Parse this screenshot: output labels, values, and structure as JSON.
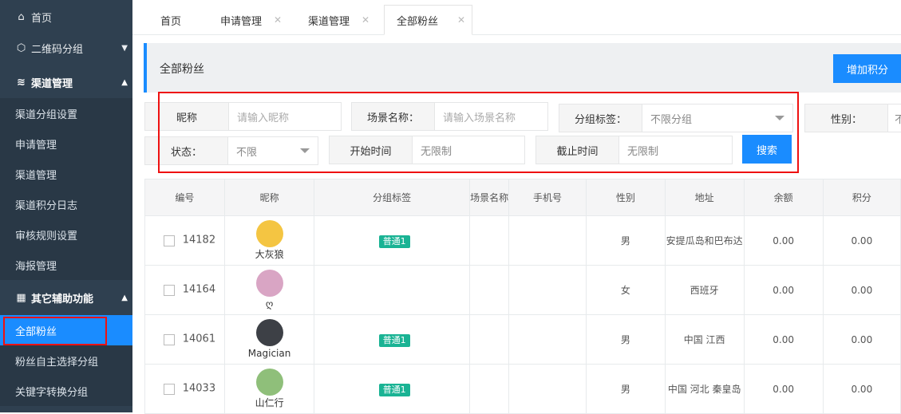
{
  "sidebar": {
    "home": "首页",
    "qrcode_group": "二维码分组",
    "channel_mgmt": "渠道管理",
    "channel_items": [
      "渠道分组设置",
      "申请管理",
      "渠道管理",
      "渠道积分日志",
      "审核规则设置",
      "海报管理"
    ],
    "other_tools": "其它辅助功能",
    "other_items": [
      "全部粉丝",
      "粉丝自主选择分组",
      "关键字转换分组"
    ]
  },
  "tabs": [
    {
      "label": "首页",
      "closable": false
    },
    {
      "label": "申请管理",
      "closable": true
    },
    {
      "label": "渠道管理",
      "closable": true
    },
    {
      "label": "全部粉丝",
      "closable": true,
      "active": true
    }
  ],
  "page": {
    "title": "全部粉丝",
    "add_points_button": "增加积分"
  },
  "filters": {
    "nickname": {
      "label": "昵称",
      "placeholder": "请输入昵称"
    },
    "scene": {
      "label": "场景名称：",
      "placeholder": "请输入场景名称"
    },
    "group_tag": {
      "label": "分组标签：",
      "value": "不限分组"
    },
    "gender": {
      "label": "性别：",
      "value": "不"
    },
    "status": {
      "label": "状态：",
      "value": "不限"
    },
    "start_time": {
      "label": "开始时间",
      "value": "无限制"
    },
    "end_time": {
      "label": "截止时间",
      "value": "无限制"
    },
    "search_button": "搜索"
  },
  "table": {
    "columns": [
      "编号",
      "昵称",
      "分组标签",
      "场景名称",
      "手机号",
      "性别",
      "地址",
      "余额",
      "积分"
    ],
    "rows": [
      {
        "id": "14182",
        "nickname": "大灰狼",
        "tag": "普通1",
        "scene": "",
        "phone": "",
        "gender": "男",
        "address": "安提瓜岛和巴布达",
        "balance": "0.00",
        "points": "0.00",
        "avatar_color": "#f4c542"
      },
      {
        "id": "14164",
        "nickname": "ღ",
        "tag": "",
        "scene": "",
        "phone": "",
        "gender": "女",
        "address": "西班牙",
        "balance": "0.00",
        "points": "0.00",
        "avatar_color": "#d9a5c4"
      },
      {
        "id": "14061",
        "nickname": "Magician",
        "tag": "普通1",
        "scene": "",
        "phone": "",
        "gender": "男",
        "address": "中国 江西",
        "balance": "0.00",
        "points": "0.00",
        "avatar_color": "#3d4046"
      },
      {
        "id": "14033",
        "nickname": "山仁行",
        "tag": "普通1",
        "scene": "",
        "phone": "",
        "gender": "男",
        "address": "中国 河北 秦皇岛",
        "balance": "0.00",
        "points": "0.00",
        "avatar_color": "#8fbf7a"
      }
    ]
  },
  "colors": {
    "accent": "#1a8cff",
    "sidebar_bg": "#2f4050",
    "badge": "#1ab394",
    "highlight_box": "#e11111"
  }
}
